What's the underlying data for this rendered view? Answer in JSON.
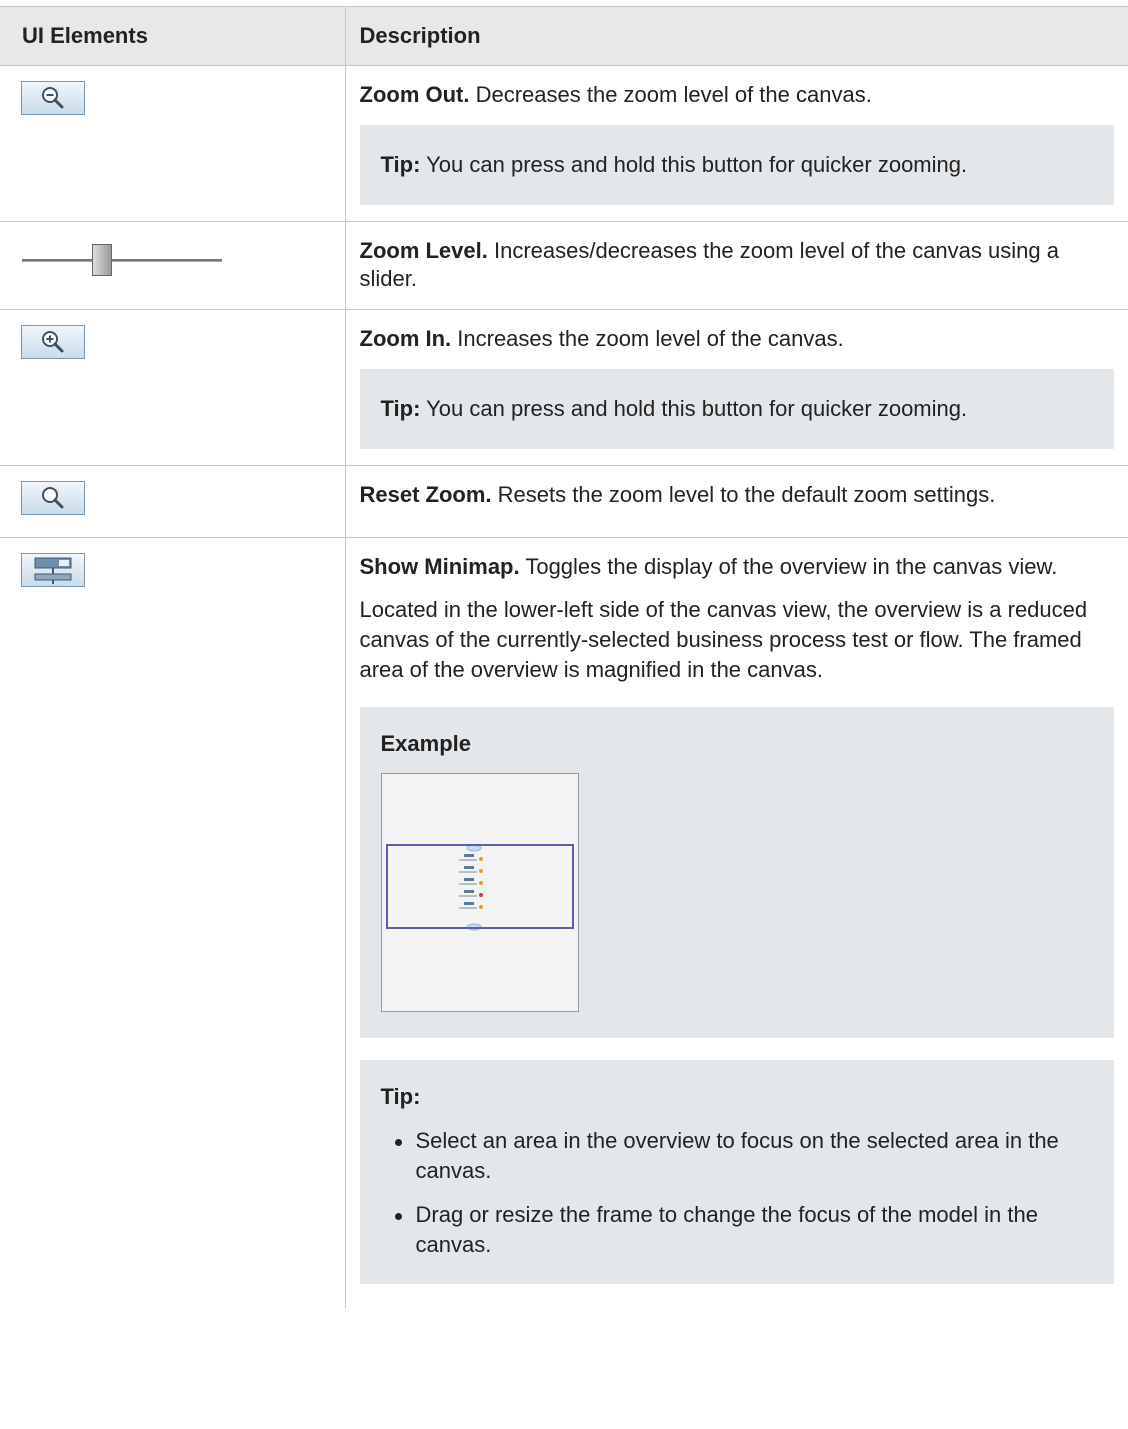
{
  "table": {
    "headers": [
      "UI Elements",
      "Description"
    ],
    "rows": [
      {
        "icon": "zoom-out-icon",
        "title": "Zoom Out.",
        "text": " Decreases the zoom level of the canvas.",
        "tip_label": "Tip:",
        "tip_text": " You can press and hold this button for quicker zooming."
      },
      {
        "icon": "zoom-level-slider",
        "title": "Zoom Level.",
        "text": " Increases/decreases the zoom level of the canvas using a slider."
      },
      {
        "icon": "zoom-in-icon",
        "title": "Zoom In.",
        "text": " Increases the zoom level of the canvas.",
        "tip_label": "Tip:",
        "tip_text": " You can press and hold this button for quicker zooming."
      },
      {
        "icon": "reset-zoom-icon",
        "title": "Reset Zoom.",
        "text": " Resets the zoom level to the default zoom settings."
      },
      {
        "icon": "show-minimap-icon",
        "title": "Show Minimap.",
        "text": " Toggles the display of the overview in the canvas view.",
        "paragraph": "Located in the lower-left side of the canvas view, the overview is a reduced canvas of the currently-selected business process test or flow. The framed area of the overview is magnified in the canvas.",
        "example_label": "Example",
        "tip_label": "Tip:",
        "tips": [
          "Select an area in the overview to focus on the selected area in the canvas.",
          "Drag or resize the frame to change the focus of the model in the canvas."
        ]
      }
    ]
  },
  "colors": {
    "header_bg": "#e8e8e8",
    "note_bg": "#e4e7ea",
    "border": "#c8c8c8",
    "minimap_frame": "#5a5db0"
  }
}
